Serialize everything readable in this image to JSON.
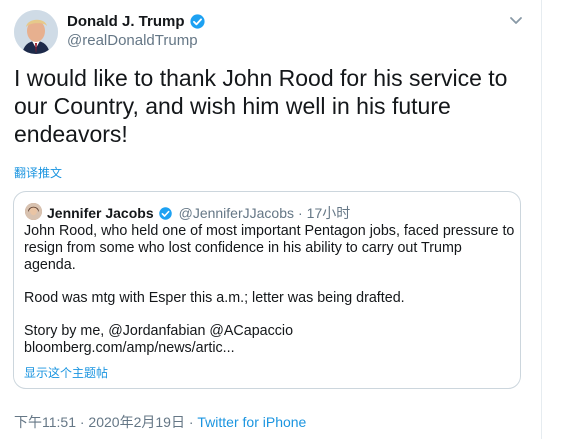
{
  "tweet": {
    "author_name": "Donald J. Trump",
    "author_handle": "@realDonaldTrump",
    "text": "I would like to thank John Rood for his service to our Country, and wish him well in his future endeavors!",
    "translate_label": "翻译推文",
    "timestamp": "下午11:51 · 2020年2月19日",
    "separator": " · ",
    "source": "Twitter for iPhone"
  },
  "quoted": {
    "author_name": "Jennifer Jacobs",
    "author_handle": "@JenniferJJacobs",
    "dot": "·",
    "time": "17小时",
    "line1": "John Rood, who held one of most important Pentagon jobs, faced pressure to resign from some who lost confidence in his ability to carry out Trump agenda.",
    "line2": "Rood was mtg with Esper this a.m.; letter was being drafted.",
    "line3": "Story by me, @Jordanfabian @ACapaccio",
    "line4": "bloomberg.com/amp/news/artic...",
    "thread_label": "显示这个主题帖"
  },
  "colors": {
    "link": "#1b95e0",
    "secondary": "#657786",
    "verified": "#1da1f2",
    "border": "#ccd6dd"
  },
  "icons": {
    "verified": "verified-badge-icon",
    "caret": "chevron-down-icon"
  }
}
